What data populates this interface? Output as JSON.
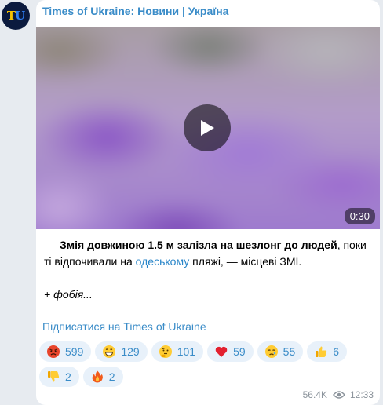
{
  "channel": {
    "avatar_text_1": "T",
    "avatar_text_2": "U",
    "name": "Times of Ukraine: Новини | Україна"
  },
  "video": {
    "duration": "0:30"
  },
  "post": {
    "bold_part": "Змія довжиною 1.5 м залізла на шезлонг до людей",
    "text_part_1": ", поки ті відпочивали на ",
    "link_text": "одеському",
    "text_part_2": " пляжі, — місцеві ЗМІ.",
    "italic_line": "+ фобія...",
    "subscribe_link": "Підписатися на Times of Ukraine"
  },
  "reactions": [
    {
      "emoji": "angry-face",
      "count": "599"
    },
    {
      "emoji": "grinning-face",
      "count": "129"
    },
    {
      "emoji": "thinking-face",
      "count": "101"
    },
    {
      "emoji": "red-heart",
      "count": "59"
    },
    {
      "emoji": "crying-face",
      "count": "55"
    },
    {
      "emoji": "thumbs-up",
      "count": "6"
    },
    {
      "emoji": "thumbs-down",
      "count": "2"
    },
    {
      "emoji": "fire",
      "count": "2"
    }
  ],
  "meta": {
    "views": "56.4K",
    "time": "12:33"
  },
  "colors": {
    "accent": "#3a8cc8",
    "link": "#2a86c9",
    "reaction_bg": "#e8f1fa"
  }
}
